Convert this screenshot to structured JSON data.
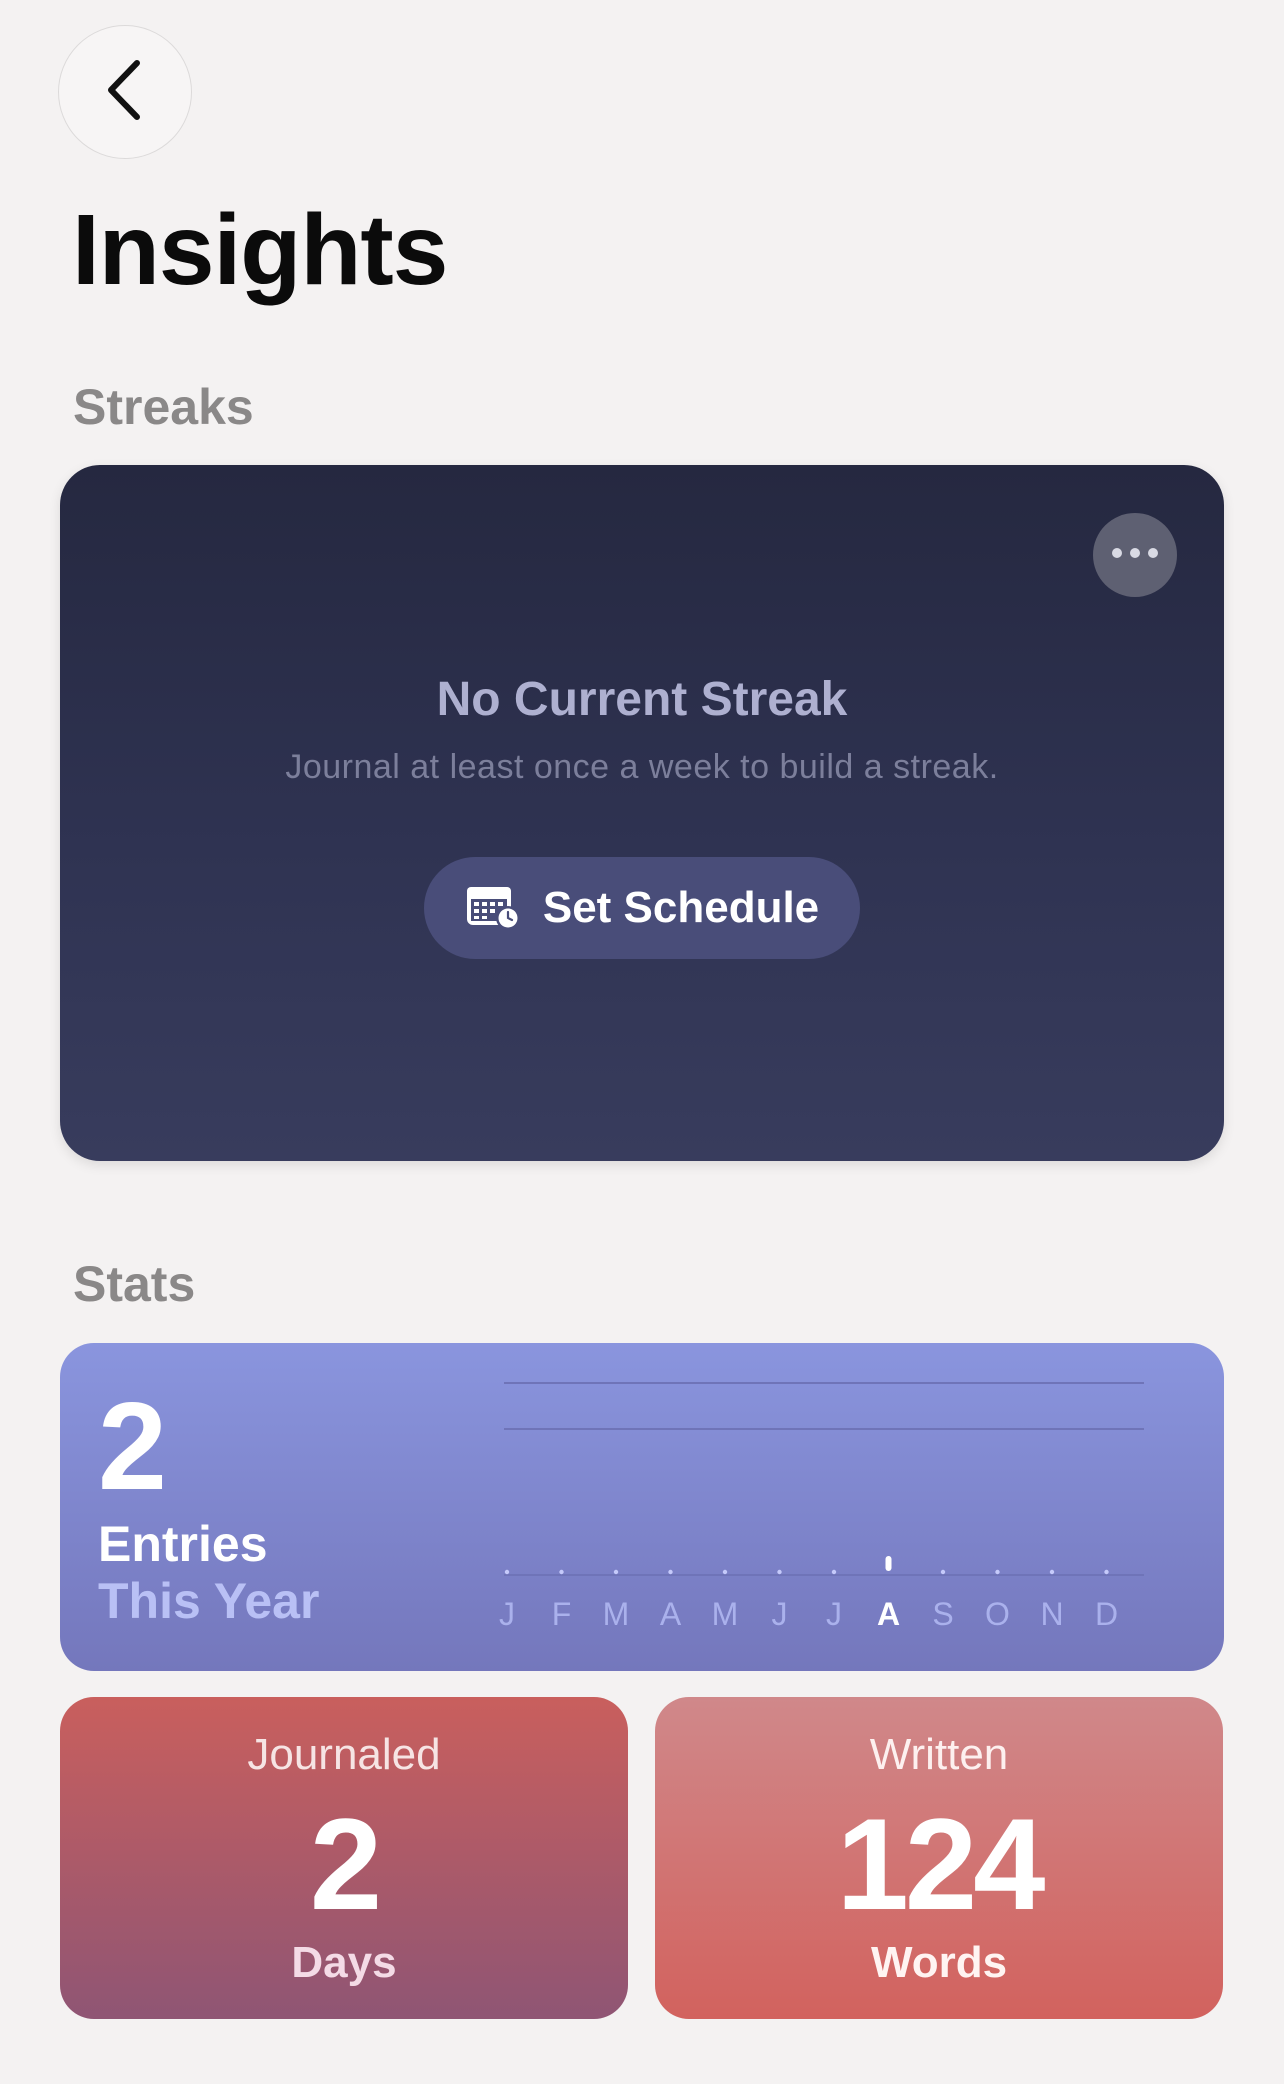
{
  "header": {
    "title": "Insights",
    "back_icon": "chevron-left-icon"
  },
  "streaks": {
    "section_label": "Streaks",
    "title": "No Current Streak",
    "subtitle": "Journal at least once a week to build a streak.",
    "schedule_button": "Set Schedule",
    "schedule_icon": "calendar-clock-icon",
    "more_icon": "ellipsis-icon"
  },
  "stats": {
    "section_label": "Stats",
    "entries": {
      "value": "2",
      "label_line1": "Entries",
      "label_line2": "This Year"
    },
    "journaled": {
      "top": "Journaled",
      "value": "2",
      "bottom": "Days"
    },
    "written": {
      "top": "Written",
      "value": "124",
      "bottom": "Words"
    }
  },
  "chart_data": {
    "type": "bar",
    "categories": [
      "J",
      "F",
      "M",
      "A",
      "M",
      "J",
      "J",
      "A",
      "S",
      "O",
      "N",
      "D"
    ],
    "values": [
      0,
      0,
      0,
      0,
      0,
      0,
      0,
      2,
      0,
      0,
      0,
      0
    ],
    "highlight_index": 7,
    "ylim": [
      0,
      6
    ],
    "grid": true,
    "colors": {
      "bar": "#ffffff",
      "gridline": "#6f74b8",
      "tick_label": "#aab1ec",
      "highlight_label": "#ffffff"
    }
  }
}
